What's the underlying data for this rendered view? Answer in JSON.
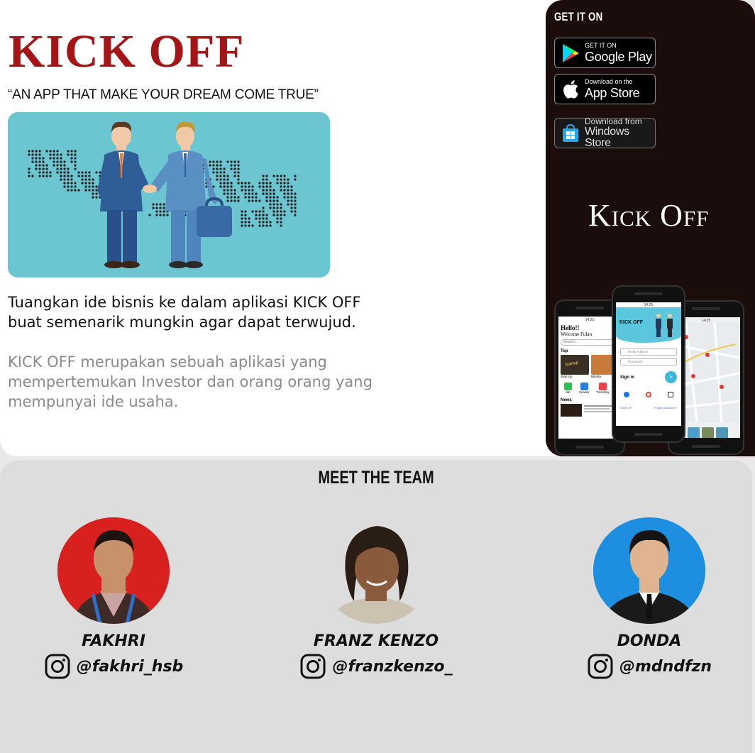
{
  "hero": {
    "title": "KICK OFF",
    "tagline": "“AN APP THAT MAKE YOUR DREAM COME TRUE”",
    "lead": "Tuangkan ide bisnis ke dalam aplikasi KICK OFF buat semenarik mungkin agar dapat terwujud.",
    "description": "KICK OFF merupakan sebuah aplikasi yang mempertemukan Investor dan orang orang yang mempunyai  ide usaha."
  },
  "download": {
    "heading": "GET IT ON",
    "stores": [
      {
        "small": "GET IT ON",
        "big": "Google Play",
        "icon": "google-play-icon"
      },
      {
        "small": "Download on the",
        "big": "App Store",
        "icon": "apple-icon"
      },
      {
        "small": "Download from",
        "big": "Windows Store",
        "icon": "windows-store-icon"
      }
    ],
    "logo": "Kick Off"
  },
  "phones": {
    "left": {
      "time": "14:25",
      "greeting": "Hello!!",
      "welcome": "Welcome Fulan",
      "search_placeholder": "Search...",
      "section_top": "Top",
      "cards": [
        "Start Up",
        "Wisata"
      ],
      "categories": [
        "Ide",
        "Inovasi",
        "Trending"
      ],
      "section_news": "News"
    },
    "center": {
      "time": "14:25",
      "app_name": "KICK OFF",
      "email_placeholder": "Email Address",
      "password_placeholder": "Password",
      "sign_in": "Sign in",
      "sign_up": "SIGN UP",
      "forgot": "Forgot password?"
    },
    "right": {
      "time": "14:25"
    }
  },
  "team": {
    "heading": "MEET THE TEAM",
    "members": [
      {
        "name": "FAKHRI",
        "handle": "@fakhri_hsb",
        "bg": "#d8201e"
      },
      {
        "name": "FRANZ KENZO",
        "handle": "@franzkenzo_",
        "bg": "#e6e6e6"
      },
      {
        "name": "DONDA",
        "handle": "@mdndfzn",
        "bg": "#1e8fe0"
      }
    ]
  },
  "colors": {
    "brand_red": "#a41518",
    "dark_panel": "#1a0d0b",
    "illustration_bg": "#6bc6d2",
    "team_bg": "#dddddd"
  }
}
